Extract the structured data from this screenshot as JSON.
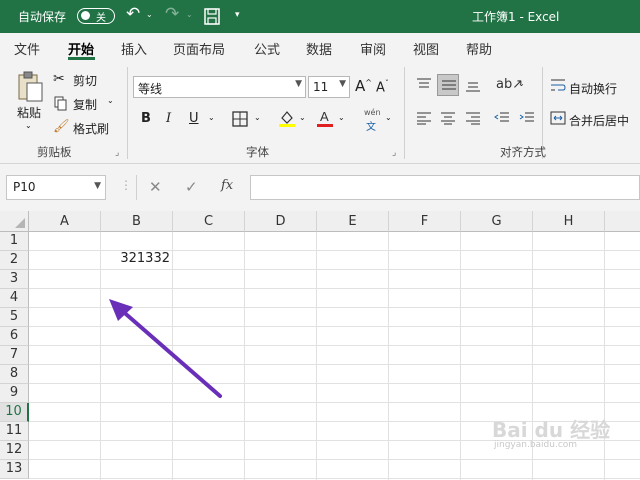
{
  "titlebar": {
    "autosave_label": "自动保存",
    "autosave_state": "关",
    "window_title": "工作簿1 - Excel",
    "bg_color": "#217346"
  },
  "tabs": [
    "文件",
    "开始",
    "插入",
    "页面布局",
    "公式",
    "数据",
    "审阅",
    "视图",
    "帮助"
  ],
  "active_tab": "开始",
  "ribbon": {
    "clipboard": {
      "paste": "粘贴",
      "cut": "剪切",
      "copy": "复制",
      "format_painter": "格式刷",
      "group_label": "剪贴板"
    },
    "font": {
      "font_name": "等线",
      "font_size": "11",
      "bold": "B",
      "italic": "I",
      "underline": "U",
      "group_label": "字体",
      "grow": "A",
      "shrink": "A",
      "phonetic_top": "wén",
      "phonetic_bottom": "文"
    },
    "alignment": {
      "wrap_text": "自动换行",
      "merge_center": "合并后居中",
      "group_label": "对齐方式"
    }
  },
  "formula_bar": {
    "name_box": "P10",
    "cancel": "✕",
    "enter": "✓",
    "fx": "fx",
    "value": ""
  },
  "sheet": {
    "columns": [
      "A",
      "B",
      "C",
      "D",
      "E",
      "F",
      "G",
      "H"
    ],
    "rows": [
      "1",
      "2",
      "3",
      "4",
      "5",
      "6",
      "7",
      "8",
      "9",
      "10",
      "11",
      "12",
      "13"
    ],
    "selected_row": "10",
    "cells": {
      "B2": "321332"
    }
  },
  "annotation_arrow_color": "#6a2fb8",
  "watermark": {
    "main": "Bai du 经验",
    "sub": "jingyan.baidu.com"
  }
}
